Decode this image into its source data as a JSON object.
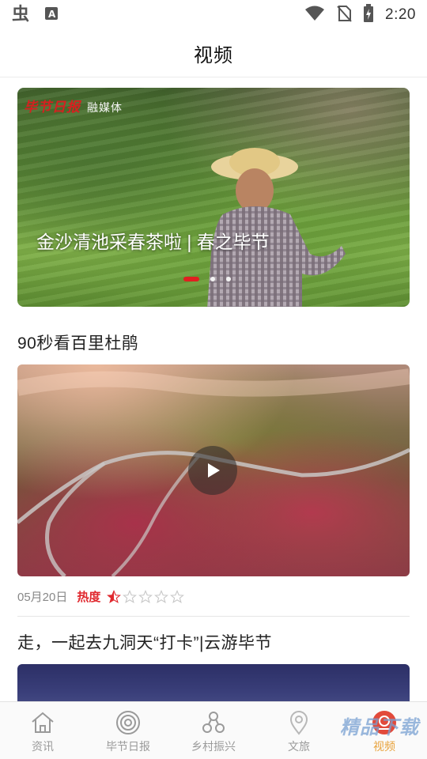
{
  "status_bar": {
    "time": "2:20"
  },
  "header": {
    "title": "视频"
  },
  "banner": {
    "logo_main": "毕节日报",
    "logo_sub": "融媒体",
    "caption": "金沙清池采春茶啦 | 春之毕节",
    "page_count": 3,
    "active_index": 0
  },
  "articles": [
    {
      "title": "90秒看百里杜鹃",
      "date": "05月20日",
      "heat_label": "热度",
      "rating": 1.5,
      "rating_max": 5
    },
    {
      "title": "走，一起去九洞天“打卡”|云游毕节"
    }
  ],
  "bottom_nav": [
    {
      "label": "资讯",
      "icon": "home-icon",
      "active": false
    },
    {
      "label": "毕节日报",
      "icon": "newspaper-target-icon",
      "active": false
    },
    {
      "label": "乡村振兴",
      "icon": "network-icon",
      "active": false
    },
    {
      "label": "文旅",
      "icon": "location-pin-icon",
      "active": false
    },
    {
      "label": "视频",
      "icon": "video-icon",
      "active": true
    }
  ],
  "watermark": "精品下载",
  "colors": {
    "accent": "#e02020",
    "nav_active": "#e8a23a",
    "nav_inactive": "#9a9a9a"
  }
}
